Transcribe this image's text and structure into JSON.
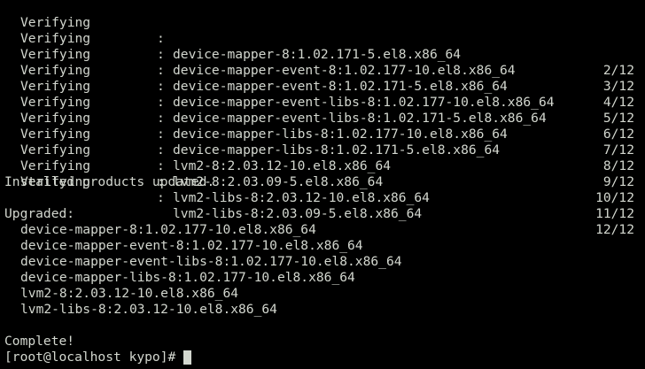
{
  "terminal": {
    "colon": ":",
    "verify_rows": [
      {
        "action": "Verifying",
        "package": "device-mapper-8:1.02.171-5.el8.x86_64",
        "count": "2/12"
      },
      {
        "action": "Verifying",
        "package": "device-mapper-event-8:1.02.177-10.el8.x86_64",
        "count": "3/12"
      },
      {
        "action": "Verifying",
        "package": "device-mapper-event-8:1.02.171-5.el8.x86_64",
        "count": "4/12"
      },
      {
        "action": "Verifying",
        "package": "device-mapper-event-libs-8:1.02.177-10.el8.x86_64",
        "count": "5/12"
      },
      {
        "action": "Verifying",
        "package": "device-mapper-event-libs-8:1.02.171-5.el8.x86_64",
        "count": "6/12"
      },
      {
        "action": "Verifying",
        "package": "device-mapper-libs-8:1.02.177-10.el8.x86_64",
        "count": "7/12"
      },
      {
        "action": "Verifying",
        "package": "device-mapper-libs-8:1.02.171-5.el8.x86_64",
        "count": "8/12"
      },
      {
        "action": "Verifying",
        "package": "lvm2-8:2.03.12-10.el8.x86_64",
        "count": "9/12"
      },
      {
        "action": "Verifying",
        "package": "lvm2-8:2.03.09-5.el8.x86_64",
        "count": "10/12"
      },
      {
        "action": "Verifying",
        "package": "lvm2-libs-8:2.03.12-10.el8.x86_64",
        "count": "11/12"
      },
      {
        "action": "Verifying",
        "package": "lvm2-libs-8:2.03.09-5.el8.x86_64",
        "count": "12/12"
      }
    ],
    "installed_message": "Installed products updated.",
    "upgraded_header": "Upgraded:",
    "upgraded_packages": [
      "device-mapper-8:1.02.177-10.el8.x86_64",
      "device-mapper-event-8:1.02.177-10.el8.x86_64",
      "device-mapper-event-libs-8:1.02.177-10.el8.x86_64",
      "device-mapper-libs-8:1.02.177-10.el8.x86_64",
      "lvm2-8:2.03.12-10.el8.x86_64",
      "lvm2-libs-8:2.03.12-10.el8.x86_64"
    ],
    "complete_message": "Complete!",
    "prompt": "[root@localhost kypo]#"
  },
  "colors": {
    "background": "#000000",
    "foreground": "#d3d7cf"
  }
}
